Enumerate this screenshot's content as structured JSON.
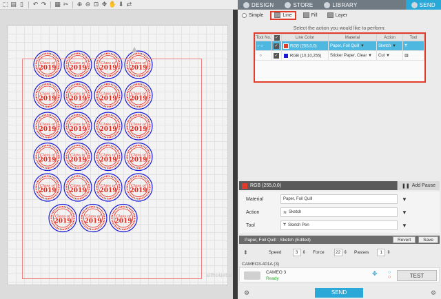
{
  "toolbar": {
    "icons": [
      "select-icon",
      "save-icon",
      "clipboard-icon",
      "undo-icon",
      "redo-icon",
      "grid-icon",
      "cut-icon",
      "zoom-in-icon",
      "zoom-out-icon",
      "zoom-fit-icon",
      "pan-icon",
      "drag-icon",
      "feed-icon",
      "settings-icon"
    ]
  },
  "canvas": {
    "sticker_text": "Class of 2019",
    "outline_color": "#1a1ad6",
    "design_color": "#e8281c",
    "rows": [
      4,
      4,
      4,
      4,
      4,
      3
    ]
  },
  "tabs": {
    "design": "DESIGN",
    "store": "STORE",
    "library": "LIBRARY",
    "send": "SEND"
  },
  "modes": {
    "simple": "Simple",
    "line": "Line",
    "fill": "Fill",
    "layer": "Layer"
  },
  "instruction": "Select the action you would like to perform:",
  "table": {
    "headers": [
      "Tool No.",
      "",
      "Line Color",
      "Material",
      "Action",
      "Tool"
    ],
    "rows": [
      {
        "color_label": "RGB (255,0,0)",
        "material": "Paper, Foil Quill",
        "action": "Sketch",
        "swatch": "#e23b2a"
      },
      {
        "color_label": "RGB (10,10,255)",
        "material": "Sticker Paper, Clear",
        "action": "Cut",
        "swatch": "#1a1ad6"
      }
    ]
  },
  "properties": {
    "header": "RGB (255,0,0)",
    "add_pause": "Add Pause",
    "material_label": "Material",
    "material_value": "Paper, Foil Quill",
    "action_label": "Action",
    "action_value": "Sketch",
    "tool_label": "Tool",
    "tool_value": "Sketch Pen"
  },
  "preset": {
    "title": "Paper, Foil Quill : Sketch (Edited)",
    "revert": "Revert",
    "save": "Save"
  },
  "params": {
    "speed_label": "Speed",
    "speed": "3",
    "force_label": "Force",
    "force": "22",
    "passes_label": "Passes",
    "passes": "1"
  },
  "device": {
    "port_name": "CAMEO3-401A (3)",
    "name": "CAMEO 3",
    "status": "Ready",
    "test": "TEST"
  },
  "send": "SEND",
  "watermark": "silhouette"
}
